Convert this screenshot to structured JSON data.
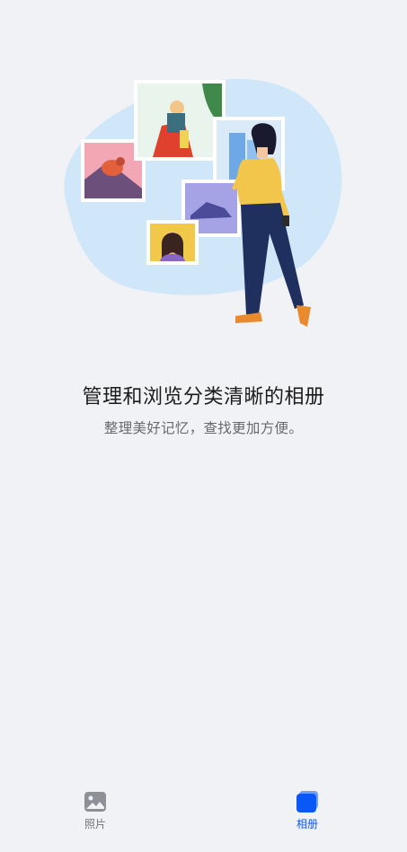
{
  "empty_state": {
    "title": "管理和浏览分类清晰的相册",
    "subtitle": "整理美好记忆，查找更加方便。"
  },
  "bottom_nav": {
    "tabs": [
      {
        "label": "照片",
        "icon": "photo-icon",
        "active": false
      },
      {
        "label": "相册",
        "icon": "albums-icon",
        "active": true
      }
    ]
  },
  "colors": {
    "background": "#f1f2f5",
    "accent": "#0a59f7",
    "inactive": "#6f7278",
    "blob": "#cfe7f8"
  }
}
